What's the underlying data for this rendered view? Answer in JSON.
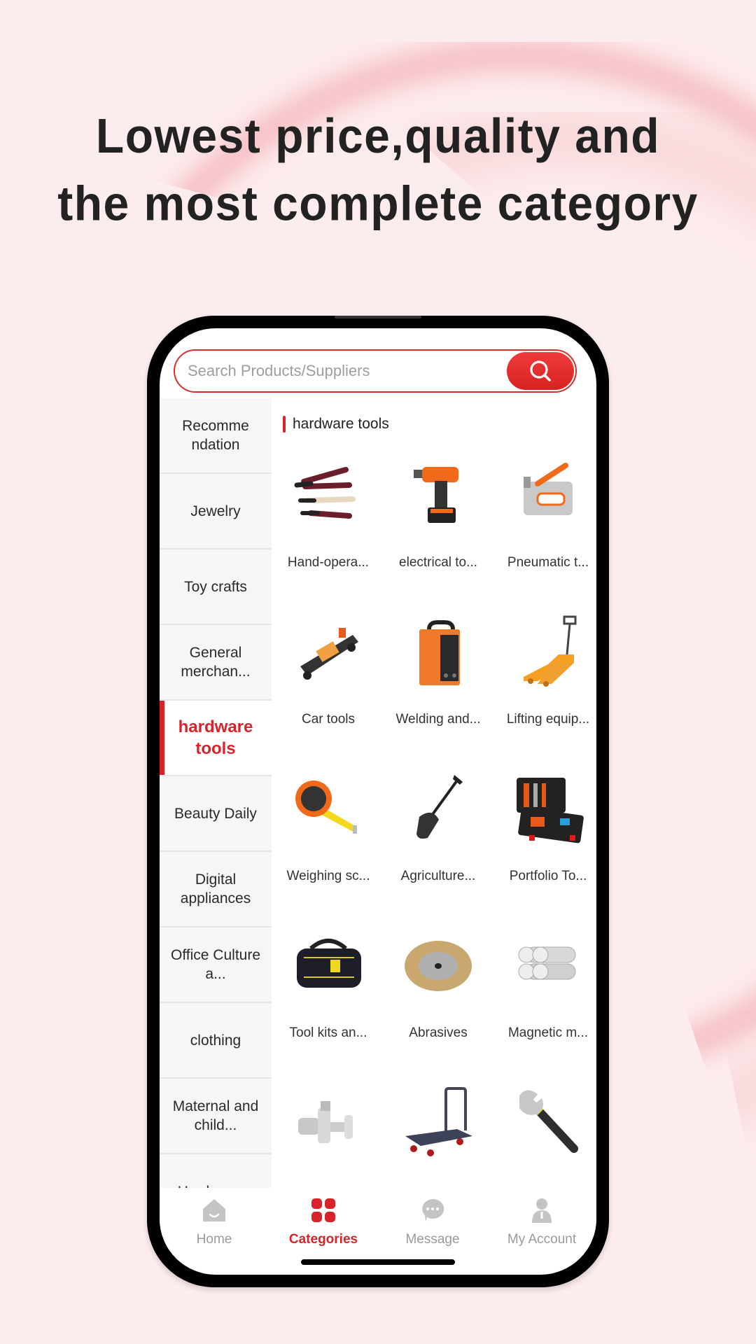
{
  "headline": {
    "line1": "Lowest price,quality and",
    "line2": "the most complete category"
  },
  "colors": {
    "accent": "#d9232a",
    "background": "#fdeced",
    "tab_inactive": "#9a9a9a"
  },
  "search": {
    "placeholder": "Search Products/Suppliers",
    "button_icon": "search-icon"
  },
  "sidebar": {
    "items": [
      {
        "label": "Recomme ndation",
        "active": false
      },
      {
        "label": "Jewelry",
        "active": false
      },
      {
        "label": "Toy crafts",
        "active": false
      },
      {
        "label": "General merchan...",
        "active": false
      },
      {
        "label": "hardware tools",
        "active": true
      },
      {
        "label": "Beauty Daily",
        "active": false
      },
      {
        "label": "Digital appliances",
        "active": false
      },
      {
        "label": "Office Culture a...",
        "active": false
      },
      {
        "label": "clothing",
        "active": false
      },
      {
        "label": "Maternal and child...",
        "active": false
      },
      {
        "label": "Hardware...",
        "active": false
      }
    ]
  },
  "content": {
    "section_title": "hardware tools",
    "items": [
      {
        "label": "Hand-opera...",
        "icon": "pliers-icon"
      },
      {
        "label": "electrical to...",
        "icon": "drill-icon"
      },
      {
        "label": "Pneumatic t...",
        "icon": "stapler-icon"
      },
      {
        "label": "Car tools",
        "icon": "car-jack-icon"
      },
      {
        "label": "Welding and...",
        "icon": "welder-icon"
      },
      {
        "label": "Lifting equip...",
        "icon": "pallet-jack-icon"
      },
      {
        "label": "Weighing sc...",
        "icon": "tape-measure-icon"
      },
      {
        "label": "Agriculture...",
        "icon": "shovel-icon"
      },
      {
        "label": "Portfolio To...",
        "icon": "toolbox-icon"
      },
      {
        "label": "Tool kits an...",
        "icon": "tool-bag-icon"
      },
      {
        "label": "Abrasives",
        "icon": "wire-wheel-icon"
      },
      {
        "label": "Magnetic m...",
        "icon": "magnets-icon"
      },
      {
        "label": "",
        "icon": "valve-icon"
      },
      {
        "label": "",
        "icon": "hand-cart-icon"
      },
      {
        "label": "",
        "icon": "wrench-icon"
      }
    ]
  },
  "tabbar": {
    "tabs": [
      {
        "label": "Home",
        "icon": "home-icon",
        "active": false
      },
      {
        "label": "Categories",
        "icon": "categories-icon",
        "active": true
      },
      {
        "label": "Message",
        "icon": "message-icon",
        "active": false
      },
      {
        "label": "My Account",
        "icon": "account-icon",
        "active": false
      }
    ]
  }
}
